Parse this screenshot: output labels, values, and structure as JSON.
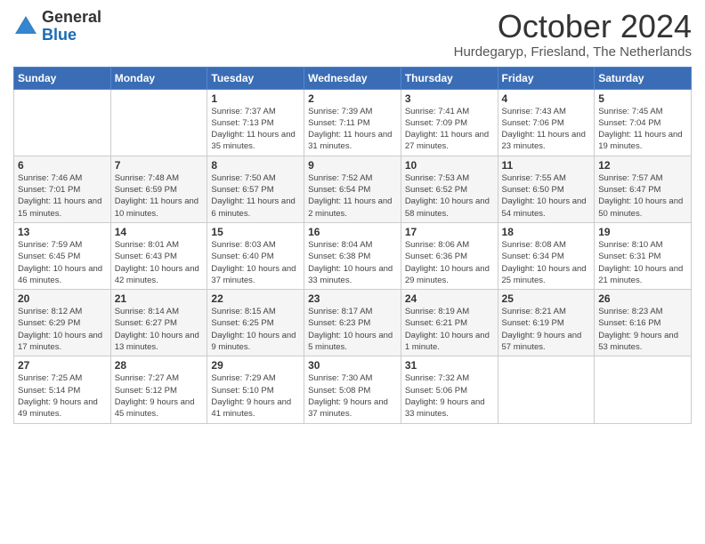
{
  "logo": {
    "general": "General",
    "blue": "Blue"
  },
  "header": {
    "title": "October 2024",
    "subtitle": "Hurdegaryp, Friesland, The Netherlands"
  },
  "weekdays": [
    "Sunday",
    "Monday",
    "Tuesday",
    "Wednesday",
    "Thursday",
    "Friday",
    "Saturday"
  ],
  "weeks": [
    [
      {
        "day": null
      },
      {
        "day": null
      },
      {
        "day": 1,
        "sunrise": "7:37 AM",
        "sunset": "7:13 PM",
        "daylight": "11 hours and 35 minutes."
      },
      {
        "day": 2,
        "sunrise": "7:39 AM",
        "sunset": "7:11 PM",
        "daylight": "11 hours and 31 minutes."
      },
      {
        "day": 3,
        "sunrise": "7:41 AM",
        "sunset": "7:09 PM",
        "daylight": "11 hours and 27 minutes."
      },
      {
        "day": 4,
        "sunrise": "7:43 AM",
        "sunset": "7:06 PM",
        "daylight": "11 hours and 23 minutes."
      },
      {
        "day": 5,
        "sunrise": "7:45 AM",
        "sunset": "7:04 PM",
        "daylight": "11 hours and 19 minutes."
      }
    ],
    [
      {
        "day": 6,
        "sunrise": "7:46 AM",
        "sunset": "7:01 PM",
        "daylight": "11 hours and 15 minutes."
      },
      {
        "day": 7,
        "sunrise": "7:48 AM",
        "sunset": "6:59 PM",
        "daylight": "11 hours and 10 minutes."
      },
      {
        "day": 8,
        "sunrise": "7:50 AM",
        "sunset": "6:57 PM",
        "daylight": "11 hours and 6 minutes."
      },
      {
        "day": 9,
        "sunrise": "7:52 AM",
        "sunset": "6:54 PM",
        "daylight": "11 hours and 2 minutes."
      },
      {
        "day": 10,
        "sunrise": "7:53 AM",
        "sunset": "6:52 PM",
        "daylight": "10 hours and 58 minutes."
      },
      {
        "day": 11,
        "sunrise": "7:55 AM",
        "sunset": "6:50 PM",
        "daylight": "10 hours and 54 minutes."
      },
      {
        "day": 12,
        "sunrise": "7:57 AM",
        "sunset": "6:47 PM",
        "daylight": "10 hours and 50 minutes."
      }
    ],
    [
      {
        "day": 13,
        "sunrise": "7:59 AM",
        "sunset": "6:45 PM",
        "daylight": "10 hours and 46 minutes."
      },
      {
        "day": 14,
        "sunrise": "8:01 AM",
        "sunset": "6:43 PM",
        "daylight": "10 hours and 42 minutes."
      },
      {
        "day": 15,
        "sunrise": "8:03 AM",
        "sunset": "6:40 PM",
        "daylight": "10 hours and 37 minutes."
      },
      {
        "day": 16,
        "sunrise": "8:04 AM",
        "sunset": "6:38 PM",
        "daylight": "10 hours and 33 minutes."
      },
      {
        "day": 17,
        "sunrise": "8:06 AM",
        "sunset": "6:36 PM",
        "daylight": "10 hours and 29 minutes."
      },
      {
        "day": 18,
        "sunrise": "8:08 AM",
        "sunset": "6:34 PM",
        "daylight": "10 hours and 25 minutes."
      },
      {
        "day": 19,
        "sunrise": "8:10 AM",
        "sunset": "6:31 PM",
        "daylight": "10 hours and 21 minutes."
      }
    ],
    [
      {
        "day": 20,
        "sunrise": "8:12 AM",
        "sunset": "6:29 PM",
        "daylight": "10 hours and 17 minutes."
      },
      {
        "day": 21,
        "sunrise": "8:14 AM",
        "sunset": "6:27 PM",
        "daylight": "10 hours and 13 minutes."
      },
      {
        "day": 22,
        "sunrise": "8:15 AM",
        "sunset": "6:25 PM",
        "daylight": "10 hours and 9 minutes."
      },
      {
        "day": 23,
        "sunrise": "8:17 AM",
        "sunset": "6:23 PM",
        "daylight": "10 hours and 5 minutes."
      },
      {
        "day": 24,
        "sunrise": "8:19 AM",
        "sunset": "6:21 PM",
        "daylight": "10 hours and 1 minute."
      },
      {
        "day": 25,
        "sunrise": "8:21 AM",
        "sunset": "6:19 PM",
        "daylight": "9 hours and 57 minutes."
      },
      {
        "day": 26,
        "sunrise": "8:23 AM",
        "sunset": "6:16 PM",
        "daylight": "9 hours and 53 minutes."
      }
    ],
    [
      {
        "day": 27,
        "sunrise": "7:25 AM",
        "sunset": "5:14 PM",
        "daylight": "9 hours and 49 minutes."
      },
      {
        "day": 28,
        "sunrise": "7:27 AM",
        "sunset": "5:12 PM",
        "daylight": "9 hours and 45 minutes."
      },
      {
        "day": 29,
        "sunrise": "7:29 AM",
        "sunset": "5:10 PM",
        "daylight": "9 hours and 41 minutes."
      },
      {
        "day": 30,
        "sunrise": "7:30 AM",
        "sunset": "5:08 PM",
        "daylight": "9 hours and 37 minutes."
      },
      {
        "day": 31,
        "sunrise": "7:32 AM",
        "sunset": "5:06 PM",
        "daylight": "9 hours and 33 minutes."
      },
      {
        "day": null
      },
      {
        "day": null
      }
    ]
  ],
  "labels": {
    "sunrise": "Sunrise:",
    "sunset": "Sunset:",
    "daylight": "Daylight:"
  }
}
